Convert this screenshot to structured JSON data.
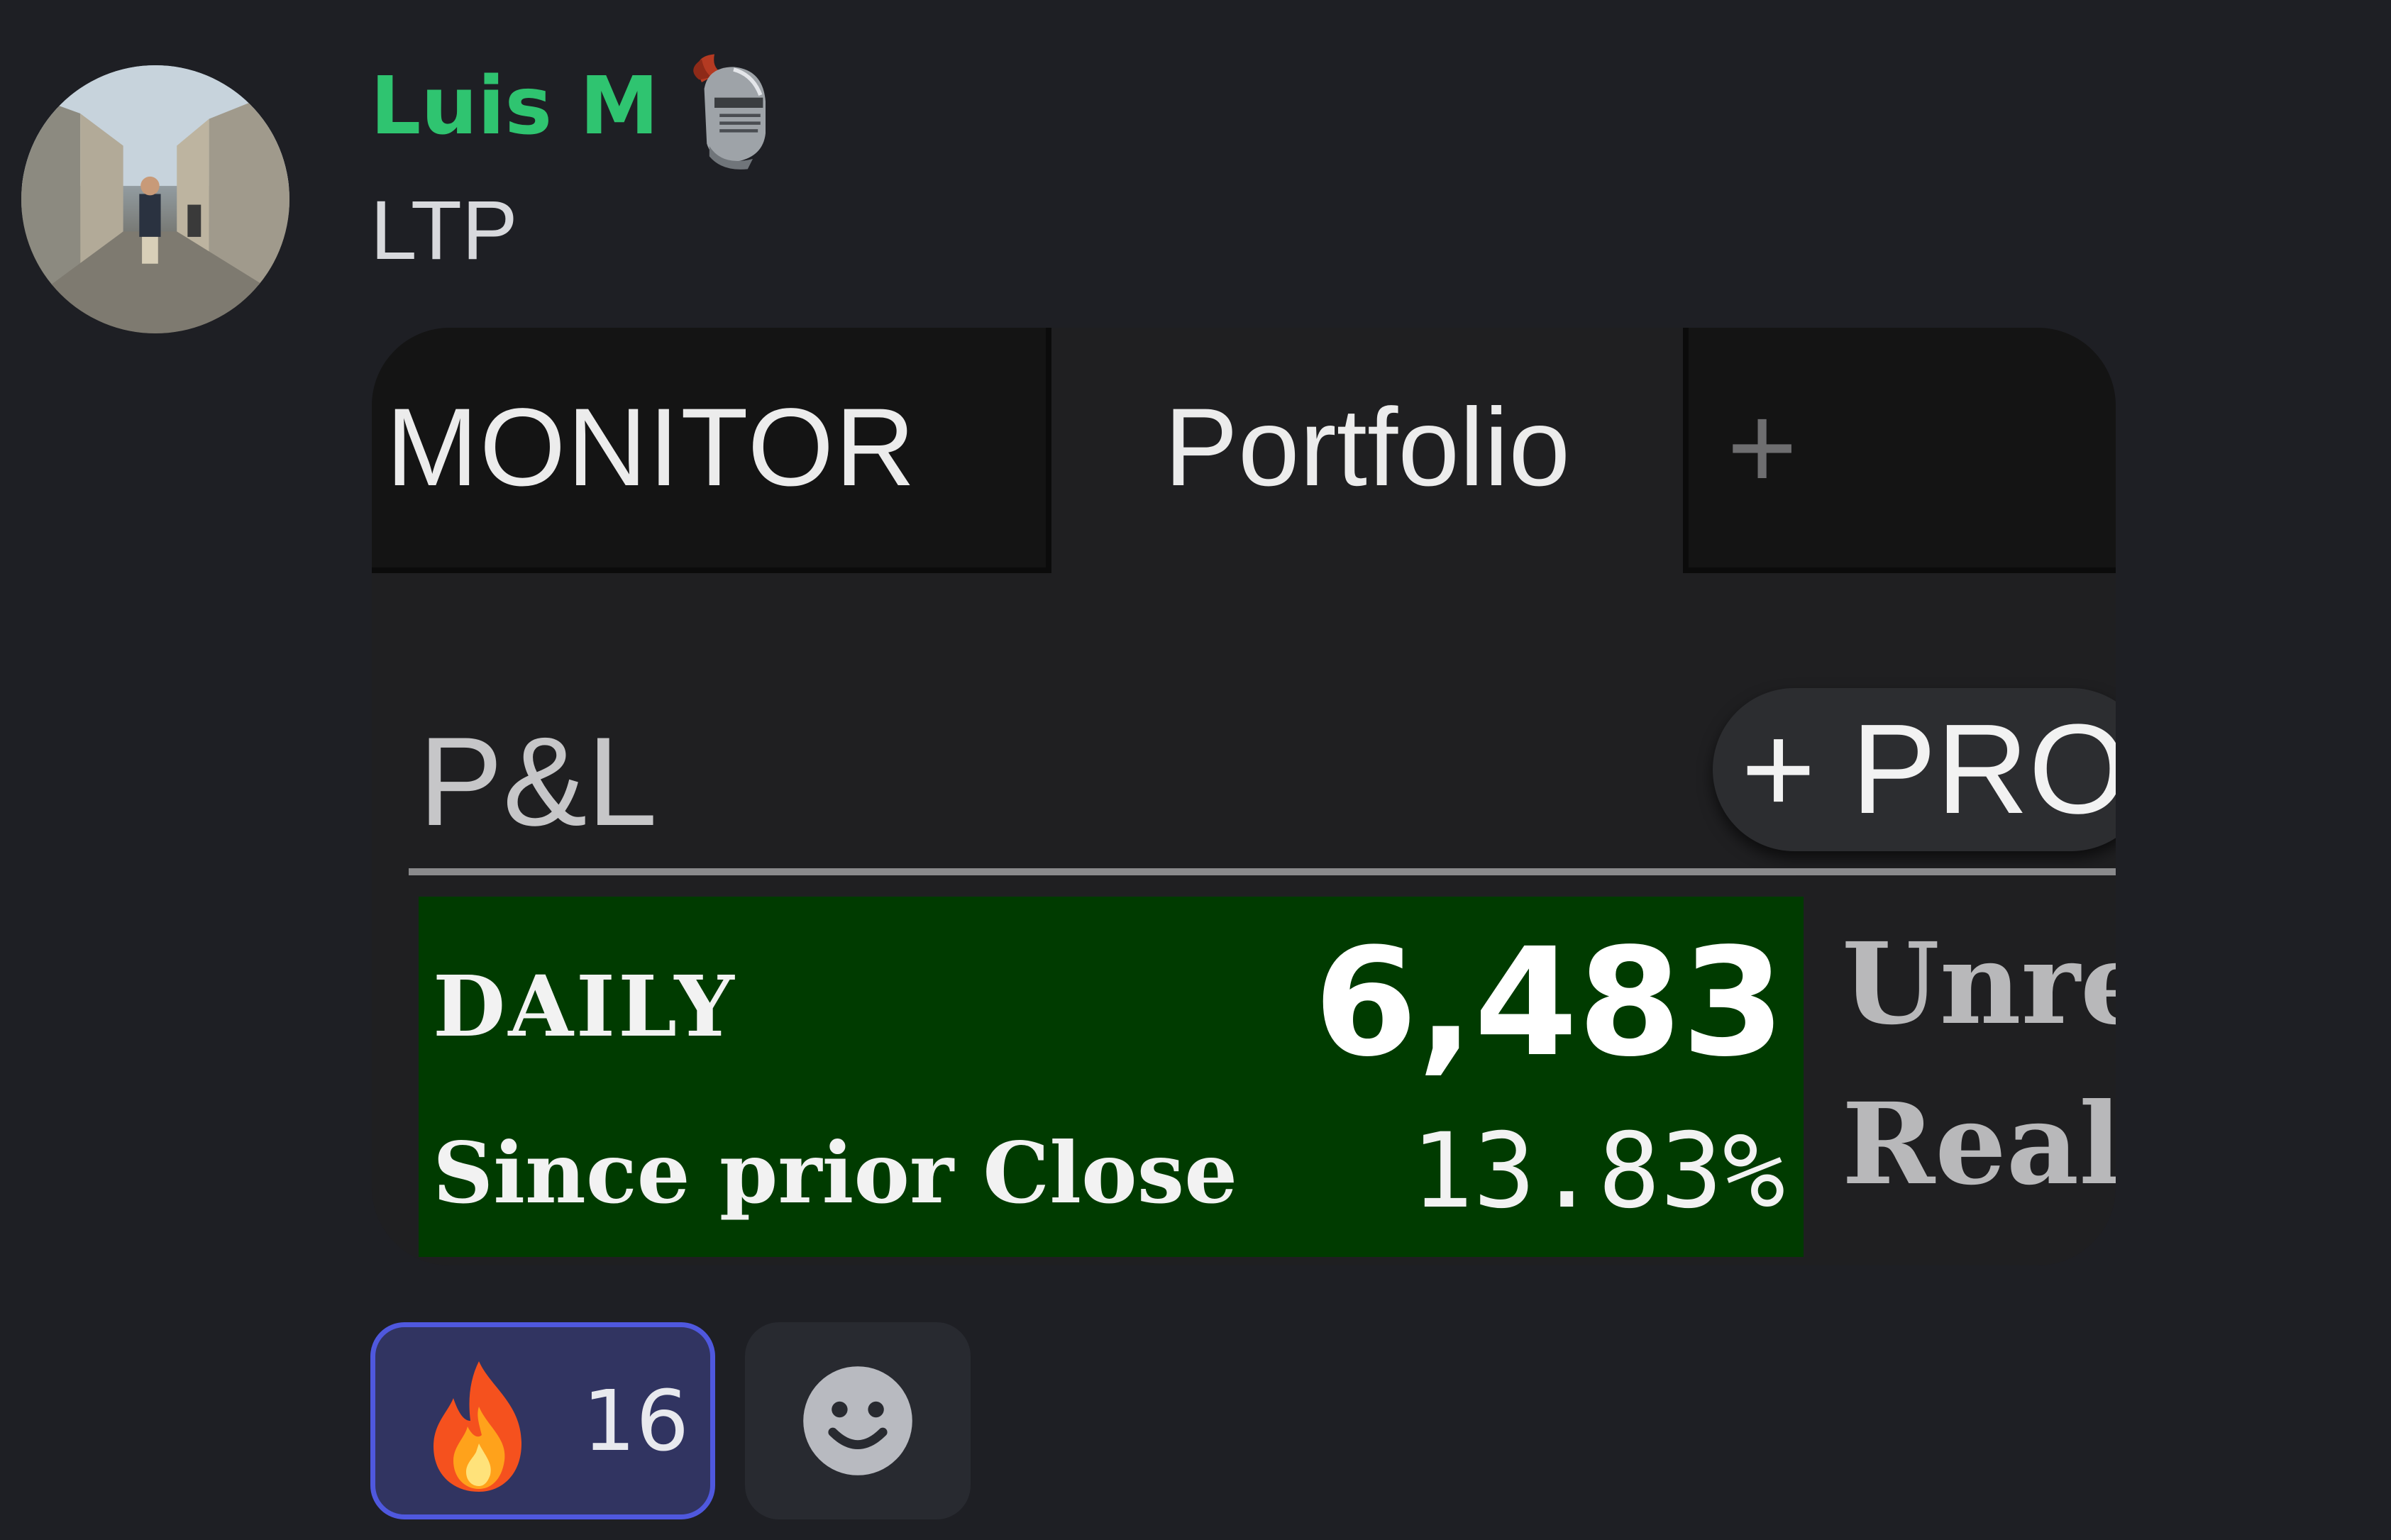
{
  "message": {
    "author": "Luis M",
    "text": "LTP"
  },
  "embed": {
    "tabs": [
      {
        "label": "MONITOR",
        "active": false
      },
      {
        "label": "Portfolio",
        "active": true
      }
    ],
    "add_tab_label": "+",
    "section_title": "P&L",
    "pro_button_label": "+ PRO",
    "daily": {
      "label": "DAILY",
      "value": "6,483",
      "since_label": "Since prior Close",
      "since_value": "13.83%",
      "background_color": "#003b00"
    },
    "side_labels": [
      "Unre",
      "Real"
    ]
  },
  "reactions": [
    {
      "emoji": "fire-icon",
      "count": "16",
      "selected": true
    }
  ],
  "add_reaction_icon": "smile-icon",
  "colors": {
    "username": "#2fc470",
    "reaction_border": "#4f58de",
    "reaction_bg": "#313461"
  }
}
